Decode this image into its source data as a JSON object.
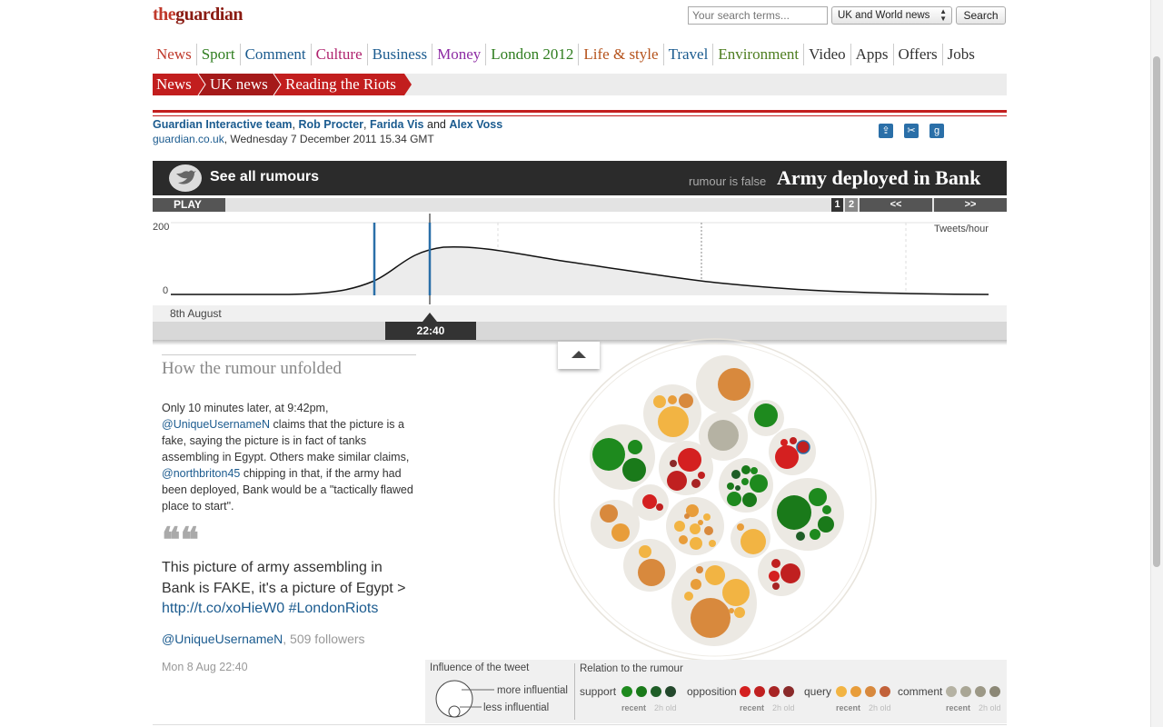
{
  "header": {
    "logo_the": "the",
    "logo_brand": "guardian",
    "search_placeholder": "Your search terms...",
    "search_scope": "UK and World news",
    "search_button": "Search"
  },
  "nav": {
    "items": [
      {
        "label": "News",
        "color": "#c0392b"
      },
      {
        "label": "Sport",
        "color": "#2f7d1f"
      },
      {
        "label": "Comment",
        "color": "#1b5b8f"
      },
      {
        "label": "Culture",
        "color": "#b0236e"
      },
      {
        "label": "Business",
        "color": "#1b5b8f"
      },
      {
        "label": "Money",
        "color": "#8d2aa3"
      },
      {
        "label": "London 2012",
        "color": "#2f7d1f"
      },
      {
        "label": "Life & style",
        "color": "#b5521b"
      },
      {
        "label": "Travel",
        "color": "#1b5b8f"
      },
      {
        "label": "Environment",
        "color": "#4d7d1f"
      },
      {
        "label": "Video",
        "color": "#333333"
      },
      {
        "label": "Apps",
        "color": "#333333"
      },
      {
        "label": "Offers",
        "color": "#333333"
      },
      {
        "label": "Jobs",
        "color": "#333333"
      }
    ]
  },
  "breadcrumb": {
    "items": [
      "News",
      "UK news",
      "Reading the Riots"
    ]
  },
  "byline": {
    "author1": "Guardian Interactive team",
    "author2": "Rob Procter",
    "author3": "Farida Vis",
    "and": "and",
    "author4": "Alex Voss",
    "site": "guardian.co.uk",
    "date": ", Wednesday 7 December 2011 15.34 GMT"
  },
  "rumour": {
    "see_all": "See all rumours",
    "status": "rumour is false",
    "title": "Army deployed in Bank"
  },
  "controls": {
    "play": "PLAY",
    "page1": "1",
    "page2": "2",
    "prev": "<<",
    "next": ">>"
  },
  "timeline": {
    "ymax_label": "200",
    "ymin_label": "0",
    "unit_label": "Tweets/hour",
    "date_label": "8th August",
    "current_time": "22:40"
  },
  "story": {
    "section_title": "How the rumour unfolded",
    "p1_a": "Only 10 minutes later, at 9:42pm, ",
    "p1_user1": "@UniqueUsernameN",
    "p1_b": " claims that the picture is a fake, saying the picture is in fact of tanks assembling in Egypt. Others make similar claims, ",
    "p1_user2": "@northbriton45",
    "p1_c": " chipping in that, if the army had been deployed, Bank would be a \"tactically flawed place to start\".",
    "quote_mark": "❝❝",
    "tweet_text": "This picture of army assembling in Bank is FAKE, it's a picture of Egypt > ",
    "tweet_link": "http://t.co/xoHieW0 #LondonRiots",
    "tweet_user": "@UniqueUsernameN",
    "tweet_followers": ", 509 followers",
    "tweet_date": "Mon 8 Aug 22:40"
  },
  "legend": {
    "influence_title": "Influence of the tweet",
    "more": "more influential",
    "less": "less influential",
    "relation_title": "Relation to the rumour",
    "categories": [
      {
        "label": "support",
        "colors": [
          "#1e8a1e",
          "#1a7a1a",
          "#1f5e27",
          "#23482c"
        ]
      },
      {
        "label": "opposition",
        "colors": [
          "#d42020",
          "#c02020",
          "#a82424",
          "#8a2a2a"
        ]
      },
      {
        "label": "query",
        "colors": [
          "#f2b443",
          "#e89d3a",
          "#d8893d",
          "#c2623a"
        ]
      },
      {
        "label": "comment",
        "colors": [
          "#b5b2a3",
          "#a9a695",
          "#9c9886",
          "#8c8876"
        ]
      }
    ],
    "recent": "recent",
    "old": "2h old"
  },
  "colors": {
    "guardian_red": "#c21e1e",
    "link_blue": "#1b5b8f",
    "dark_bar": "#2b2b2b"
  }
}
